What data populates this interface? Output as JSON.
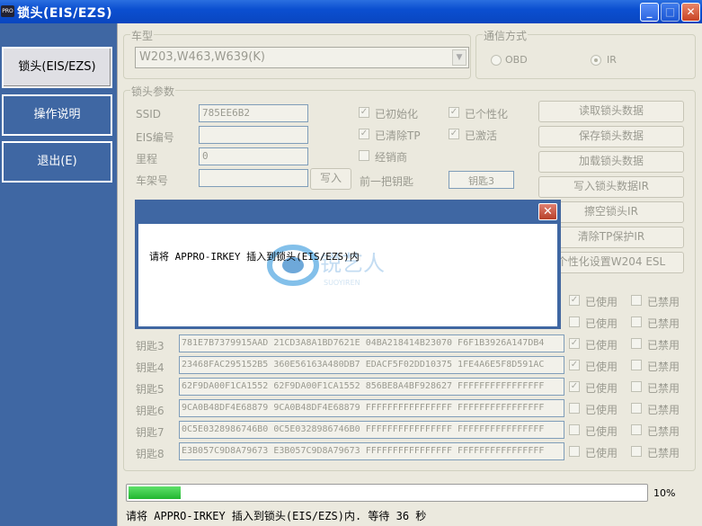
{
  "window": {
    "title": "锁头(EIS/EZS)",
    "app_icon": "PRO"
  },
  "sidebar": {
    "items": [
      {
        "label": "锁头(EIS/EZS)",
        "active": true
      },
      {
        "label": "操作说明",
        "active": false
      },
      {
        "label": "退出(E)",
        "active": false
      }
    ]
  },
  "vehicle": {
    "group_label": "车型",
    "value": "W203,W463,W639(K)"
  },
  "comm": {
    "group_label": "通信方式",
    "option_obd": "OBD",
    "option_ir": "IR",
    "selected": "IR"
  },
  "lock": {
    "group_label": "锁头参数",
    "ssid_label": "SSID",
    "ssid_value": "785EE6B2",
    "eis_label": "EIS编号",
    "eis_value": "",
    "mileage_label": "里程",
    "mileage_value": "0",
    "vin_label": "车架号",
    "vin_value": "",
    "write_label": "写入",
    "prev_key_label": "前一把钥匙",
    "prev_key_value": "钥匙3",
    "checks": [
      {
        "label": "已初始化",
        "checked": true
      },
      {
        "label": "已个性化",
        "checked": true
      },
      {
        "label": "已清除TP",
        "checked": true
      },
      {
        "label": "已激活",
        "checked": true
      },
      {
        "label": "经销商",
        "checked": false
      }
    ]
  },
  "actions": [
    "读取锁头数据",
    "保存锁头数据",
    "加载锁头数据",
    "写入锁头数据IR",
    "擦空锁头IR",
    "清除TP保护IR",
    "个性化设置W204 ESL"
  ],
  "keys": {
    "used_label": "已使用",
    "disabled_label": "已禁用",
    "rows": [
      {
        "label": "",
        "value": "",
        "used": true,
        "disabled": false
      },
      {
        "label": "",
        "value": "",
        "used": false,
        "disabled": false
      },
      {
        "label": "钥匙3",
        "value": "781E7B7379915AAD 21CD3A8A1BD7621E 04BA218414B23070 F6F1B3926A147DB4",
        "used": true,
        "disabled": false
      },
      {
        "label": "钥匙4",
        "value": "23468FAC295152B5 360E56163A480DB7 EDACF5F02DD10375 1FE4A6E5F8D591AC",
        "used": true,
        "disabled": false
      },
      {
        "label": "钥匙5",
        "value": "62F9DA00F1CA1552 62F9DA00F1CA1552 856BE8A4BF928627 FFFFFFFFFFFFFFFF",
        "used": true,
        "disabled": false
      },
      {
        "label": "钥匙6",
        "value": "9CA0B48DF4E68879 9CA0B48DF4E68879 FFFFFFFFFFFFFFFF FFFFFFFFFFFFFFFF",
        "used": false,
        "disabled": false
      },
      {
        "label": "钥匙7",
        "value": "0C5E0328986746B0 0C5E0328986746B0 FFFFFFFFFFFFFFFF FFFFFFFFFFFFFFFF",
        "used": false,
        "disabled": false
      },
      {
        "label": "钥匙8",
        "value": "E3B057C9D8A79673 E3B057C9D8A79673 FFFFFFFFFFFFFFFF FFFFFFFFFFFFFFFF",
        "used": false,
        "disabled": false
      }
    ]
  },
  "progress": {
    "percent": 10,
    "label": "10%"
  },
  "status": {
    "text": "请将 APPRO-IRKEY 插入到锁头(EIS/EZS)内. 等待 36 秒"
  },
  "dialog": {
    "message": "请将 APPRO-IRKEY 插入到锁头(EIS/EZS)内",
    "close_icon": "close-icon"
  },
  "watermark": {
    "text": "锐艺人",
    "subtext": "SUOYIREN"
  },
  "colors": {
    "sidebar": "#3f67a3",
    "titlebar": "#0b4fd0",
    "progress": "#22b630",
    "panel": "#ebe9de"
  }
}
